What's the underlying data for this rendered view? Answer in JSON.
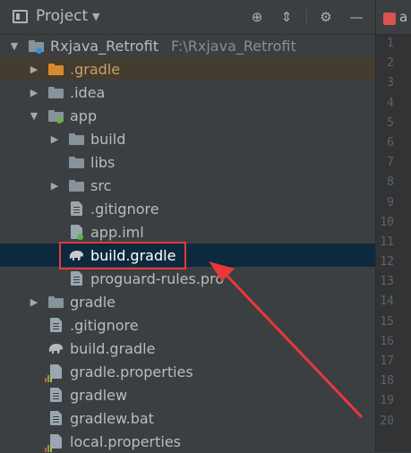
{
  "header": {
    "title": "Project",
    "icons": [
      "locate-icon",
      "collapse-icon",
      "gear-icon",
      "minimize-icon"
    ]
  },
  "tree": {
    "root": {
      "label": "Rxjava_Retrofit",
      "path": "F:\\Rxjava_Retrofit"
    },
    "items": [
      {
        "label": ".gradle"
      },
      {
        "label": ".idea"
      },
      {
        "label": "app"
      },
      {
        "label": "build"
      },
      {
        "label": "libs"
      },
      {
        "label": "src"
      },
      {
        "label": ".gitignore"
      },
      {
        "label": "app.iml"
      },
      {
        "label": "build.gradle"
      },
      {
        "label": "proguard-rules.pro"
      },
      {
        "label": "gradle"
      },
      {
        "label": ".gitignore"
      },
      {
        "label": "build.gradle"
      },
      {
        "label": "gradle.properties"
      },
      {
        "label": "gradlew"
      },
      {
        "label": "gradlew.bat"
      },
      {
        "label": "local.properties"
      }
    ]
  },
  "editor": {
    "tab_label": "a",
    "line_numbers": [
      "1",
      "2",
      "3",
      "4",
      "5",
      "6",
      "7",
      "8",
      "9",
      "10",
      "11",
      "12",
      "13",
      "14",
      "15",
      "16",
      "17",
      "18",
      "19",
      "20"
    ]
  },
  "colors": {
    "selection": "#0d293e",
    "highlight": "#e8383a",
    "arrow": "#e8383a"
  }
}
